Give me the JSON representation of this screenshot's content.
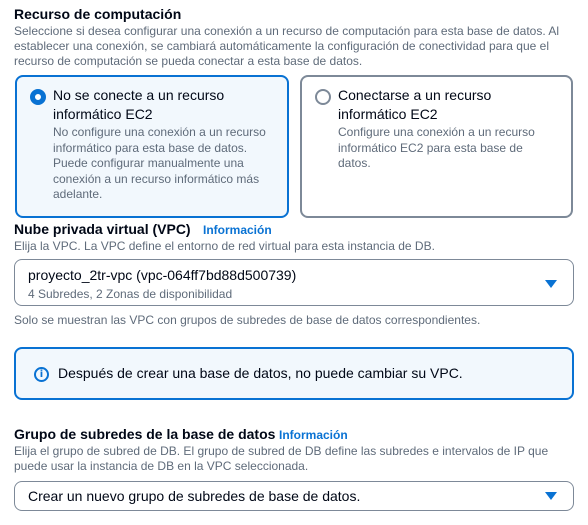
{
  "compute": {
    "title": "Recurso de computación",
    "description_lines": [
      "Seleccione si desea configurar una conexión a un recurso de computación para esta base de datos. Al",
      "establecer una conexión, se cambiará automáticamente la configuración de conectividad para que el",
      "recurso de computación se pueda conectar a esta base de datos."
    ],
    "options": [
      {
        "selected": true,
        "title_lines": [
          "No se conecte a un recurso",
          "informático EC2"
        ],
        "description_lines": [
          "No configure una conexión a un recurso",
          "informático para esta base de datos.",
          "Puede configurar manualmente una",
          "conexión a un recurso informático más",
          "adelante."
        ]
      },
      {
        "selected": false,
        "title_lines": [
          "Conectarse a un recurso",
          "informático EC2"
        ],
        "description_lines": [
          "Configure una conexión a un recurso",
          "informático EC2 para esta base de",
          "datos."
        ]
      }
    ]
  },
  "vpc": {
    "title": "Nube privada virtual (VPC)",
    "info_link": "Información",
    "description": "Elija la VPC. La VPC define el entorno de red virtual para esta instancia de DB.",
    "selected_value": "proyecto_2tr-vpc (vpc-064ff7bd88d500739)",
    "selected_detail": "4 Subredes, 2 Zonas de disponibilidad",
    "hint": "Solo se muestran las VPC con grupos de subredes de base de datos correspondientes."
  },
  "alert": {
    "icon": "info-icon",
    "text": "Después de crear una base de datos, no puede cambiar su VPC."
  },
  "subnet_group": {
    "title": "Grupo de subredes de la base de datos",
    "info_link": "Información",
    "description_lines": [
      "Elija el grupo de subred de DB. El grupo de subred de DB define las subredes e intervalos de IP que",
      "puede usar la instancia de DB en la VPC seleccionada."
    ],
    "selected_value": "Crear un nuevo grupo de subredes de base de datos."
  },
  "colors": {
    "accent": "#0972d3",
    "selected_bg": "#f2f8fd",
    "text": "#000716",
    "secondary_text": "#5f6b7a",
    "border": "#7d8998"
  }
}
